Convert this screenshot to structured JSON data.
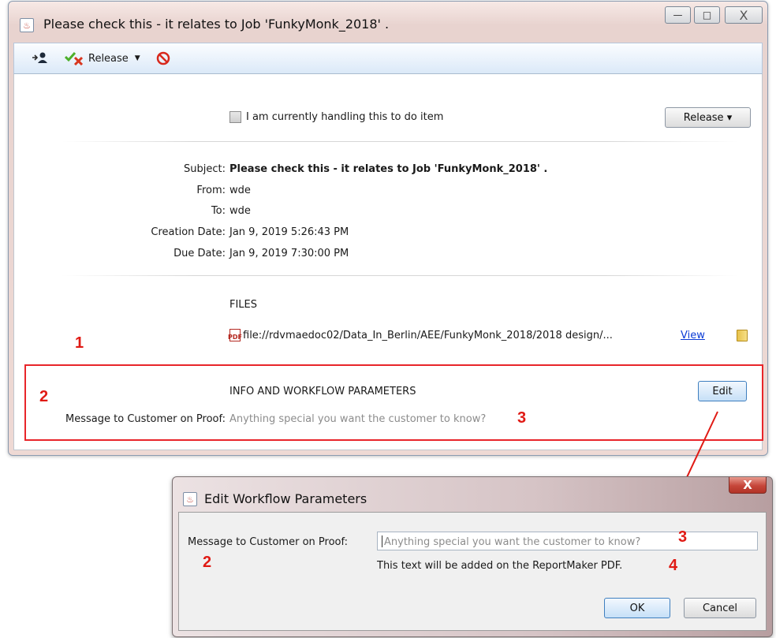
{
  "main_window": {
    "title": "Please check this - it relates to Job 'FunkyMonk_2018' .",
    "window_buttons": {
      "minimize": "—",
      "maximize": "□",
      "close": "X"
    },
    "toolbar": {
      "assign_icon": "assign-user-icon",
      "release_label": "Release",
      "release_icon": "check-cross-icon",
      "cancel_icon": "stop-icon"
    },
    "handling_checkbox_label": "I am currently handling this to do item",
    "release_button": "Release ▾",
    "fields": {
      "subject_label": "Subject:",
      "subject_value": "Please check this - it relates to Job 'FunkyMonk_2018' .",
      "from_label": "From:",
      "from_value": "wde",
      "to_label": "To:",
      "to_value": "wde",
      "creation_label": "Creation Date:",
      "creation_value": "Jan 9, 2019 5:26:43 PM",
      "due_label": "Due Date:",
      "due_value": "Jan 9, 2019 7:30:00 PM"
    },
    "files": {
      "heading": "FILES",
      "path": "file://rdvmaedoc02/Data_In_Berlin/AEE/FunkyMonk_2018/2018 design/...",
      "view_link": "View"
    },
    "parameters": {
      "heading": "INFO AND WORKFLOW PARAMETERS",
      "edit_button": "Edit",
      "message_label": "Message to Customer on Proof:",
      "message_placeholder": "Anything special you want the customer to know?"
    }
  },
  "annotations": {
    "n1": "1",
    "n2": "2",
    "n3": "3",
    "n4": "4",
    "color": "#e01a14"
  },
  "dialog": {
    "title": "Edit Workflow Parameters",
    "close": "X",
    "message_label": "Message to Customer on Proof:",
    "message_placeholder": "Anything special you want the customer to know?",
    "hint": "This text will be added on the ReportMaker PDF.",
    "ok_button": "OK",
    "cancel_button": "Cancel"
  }
}
